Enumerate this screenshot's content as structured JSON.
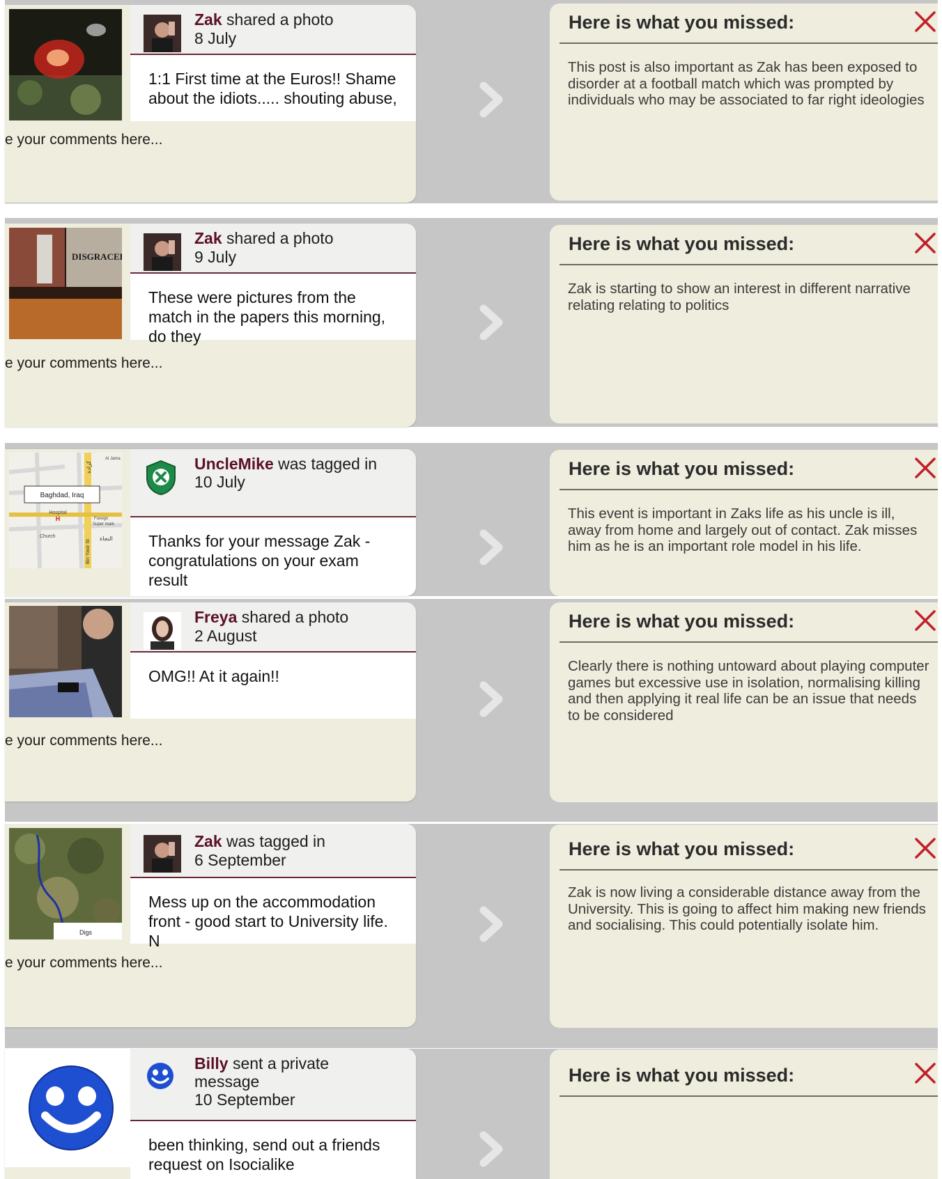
{
  "comments_placeholder": "e your comments here...",
  "missed_title": "Here is what you missed:",
  "posts": [
    {
      "name": "Zak",
      "action": " shared a photo",
      "date": "8 July",
      "message": "1:1 First time at the Euros!! Shame about the idiots..... shouting abuse,",
      "missed_text": " This post is also important as Zak has been exposed to disorder at a football match which was prompted by individuals who may be associated to far right ideologies"
    },
    {
      "name": "Zak",
      "action": " shared a photo",
      "date": "9 July",
      "message": "These were pictures from the match in the papers this morning, do they",
      "thumb_text": "DISGRACED",
      "missed_text": "Zak is starting to show an interest in different narrative relating relating to politics"
    },
    {
      "name": "UncleMike",
      "action": " was tagged in",
      "date": "10 July",
      "message": "Thanks for your message Zak - congratulations on your exam result",
      "map_labels": {
        "callout": "Baghdad, Iraq",
        "hospital": "Hospital",
        "hospital_mark": "H",
        "church": "Church",
        "foreign": "Foreign",
        "supermkt": "Super mark",
        "street": "Bin Yasir St",
        "arabic_1": "كرادة",
        "arabic_2": "النجاة",
        "top_right": "Al Jama"
      },
      "missed_text": "This event is important in Zaks life as his uncle is ill, away from home and largely out of contact. Zak misses him as he is an important role model in his life."
    },
    {
      "name": "Freya",
      "action": " shared a photo",
      "date": "2 August",
      "message": "OMG!! At it again!!",
      "missed_text": "Clearly there is nothing untoward about playing computer games but excessive use in isolation, normalising killing and then applying it real life can be an issue that needs to be considered"
    },
    {
      "name": "Zak",
      "action": " was tagged in",
      "date": "6 September",
      "message": "Mess up on the accommodation front - good start to University life. N",
      "map_label": "Digs",
      "missed_text": "Zak is now living a considerable distance away from the University. This is going to affect him making new friends and socialising. This could potentially isolate him."
    },
    {
      "name": "Billy",
      "action": " sent a private",
      "action2": "message",
      "date": "10 September",
      "message": "been thinking, send out a friends request on Isocialike",
      "missed_text": ""
    }
  ],
  "colors": {
    "name": "#5b1125",
    "divider": "#6a2738",
    "card": "#efeddd",
    "strip": "#c6c6c6",
    "close": "#c0202a"
  },
  "icons": {
    "arrow": "chevron-right-icon",
    "close": "close-x-icon",
    "shield": "shield-x-icon",
    "smiley": "smiley-icon"
  }
}
